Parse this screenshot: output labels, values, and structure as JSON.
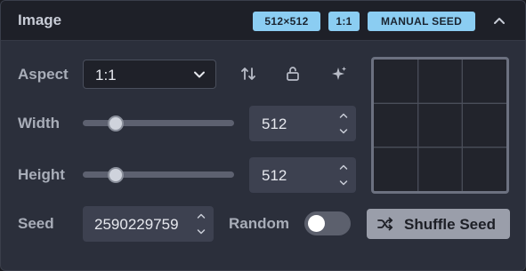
{
  "section": {
    "title": "Image",
    "badges": [
      "512×512",
      "1:1",
      "MANUAL SEED"
    ]
  },
  "aspect": {
    "label": "Aspect",
    "value": "1:1",
    "icons": [
      "swap-vertical-icon",
      "unlock-icon",
      "sparkle-icon"
    ]
  },
  "width": {
    "label": "Width",
    "value": "512",
    "slider_fraction": 0.22
  },
  "height": {
    "label": "Height",
    "value": "512",
    "slider_fraction": 0.22
  },
  "seed": {
    "label": "Seed",
    "value": "2590229759",
    "random_label": "Random",
    "random_on": false,
    "shuffle_label": "Shuffle Seed"
  },
  "colors": {
    "badge": "#8bcdf2",
    "panel": "#2b2f3b",
    "header": "#1e2028",
    "shuffle_button": "#9a9eaa"
  }
}
